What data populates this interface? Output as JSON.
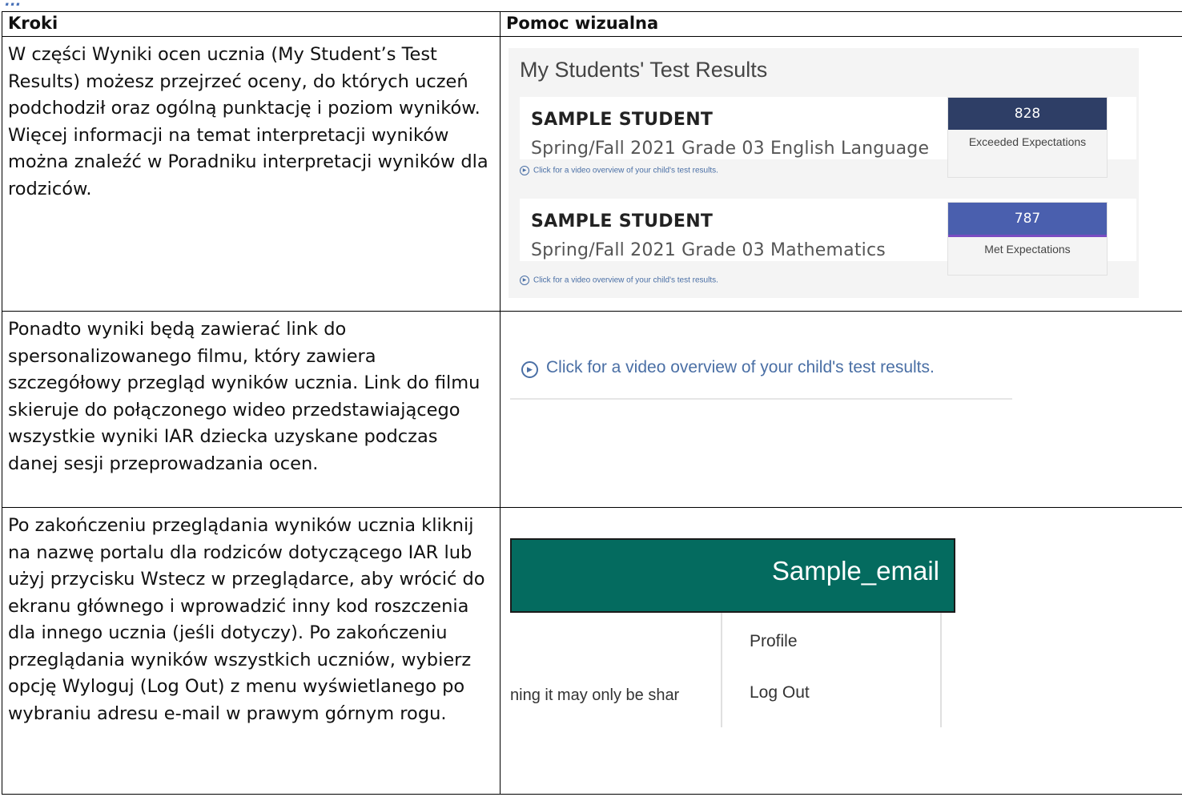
{
  "top_fragment": "...",
  "header": {
    "col_steps": "Kroki",
    "col_visual": "Pomoc wizualna"
  },
  "rows": [
    {
      "step_text": "W części Wyniki ocen ucznia (My Student’s Test Results) możesz przejrzeć oceny, do których uczeń podchodził oraz ogólną punktację i poziom wyników.\nWięcej informacji na temat interpretacji wyników można znaleźć w Poradniku interpretacji wyników dla rodziców."
    },
    {
      "step_text": "Ponadto wyniki będą zawierać link do spersonalizowanego filmu, który zawiera szczegółowy przegląd wyników ucznia. Link do filmu skieruje do połączonego wideo przedstawiającego wszystkie wyniki IAR dziecka uzyskane podczas danej sesji przeprowadzania ocen."
    },
    {
      "step_text": "Po zakończeniu przeglądania wyników ucznia kliknij na nazwę portalu dla rodziców dotyczącego IAR lub użyj przycisku Wstecz w przeglądarce, aby wrócić do ekranu głównego i wprowadzić inny kod roszczenia dla innego ucznia (jeśli dotyczy). Po zakończeniu przeglądania wyników wszystkich uczniów, wybierz opcję Wyloguj (Log Out) z menu wyświetlanego po wybraniu adresu e-mail w prawym górnym rogu."
    }
  ],
  "results_visual": {
    "title": "My Students' Test Results",
    "results": [
      {
        "student": "SAMPLE STUDENT",
        "test": "Spring/Fall 2021 Grade 03 English Language",
        "score": "828",
        "level": "Exceeded Expectations",
        "link": "Click for a video overview of your child's test results."
      },
      {
        "student": "SAMPLE STUDENT",
        "test": "Spring/Fall 2021 Grade 03 Mathematics",
        "score": "787",
        "level": "Met Expectations",
        "link": "Click for a video overview of your child's test results."
      }
    ]
  },
  "video_visual": {
    "link_text": "Click for a video overview of your child's test results."
  },
  "menu_visual": {
    "email": "Sample_email",
    "items": [
      "Profile",
      "Log Out"
    ],
    "snippet": "ning it may only be shar"
  },
  "colors": {
    "header_bar": "#046b5f",
    "score_dark": "#2e3e66",
    "score_blue": "#4a5fae",
    "link": "#4a6fa5"
  },
  "icons": {
    "video": "play-circle-icon"
  }
}
